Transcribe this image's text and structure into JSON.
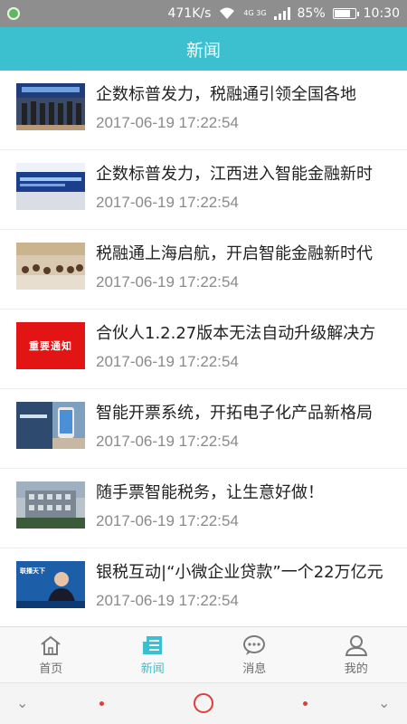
{
  "status_bar": {
    "speed": "471K/s",
    "signal": "4G 3G",
    "battery": "85%",
    "battery_level": 0.85,
    "time": "10:30"
  },
  "header": {
    "title": "新闻"
  },
  "news": [
    {
      "title": "企数标普发力，税融通引领全国各地",
      "date": "2017-06-19 17:22:54"
    },
    {
      "title": "企数标普发力，江西进入智能金融新时",
      "date": "2017-06-19 17:22:54"
    },
    {
      "title": "税融通上海启航，开启智能金融新时代",
      "date": "2017-06-19 17:22:54"
    },
    {
      "title": "合伙人1.2.27版本无法自动升级解决方",
      "date": "2017-06-19 17:22:54",
      "thumb_text": "重要通知"
    },
    {
      "title": "智能开票系统，开拓电子化产品新格局",
      "date": "2017-06-19 17:22:54"
    },
    {
      "title": "随手票智能税务，让生意好做！",
      "date": "2017-06-19 17:22:54"
    },
    {
      "title": "银税互动|“小微企业贷款”一个22万亿元",
      "date": "2017-06-19 17:22:54",
      "thumb_text": "联播天下"
    }
  ],
  "bottom_nav": [
    {
      "label": "首页",
      "icon": "home-icon",
      "active": false
    },
    {
      "label": "新闻",
      "icon": "news-icon",
      "active": true
    },
    {
      "label": "消息",
      "icon": "message-icon",
      "active": false
    },
    {
      "label": "我的",
      "icon": "profile-icon",
      "active": false
    }
  ],
  "colors": {
    "accent": "#3cbfcf",
    "status_bar": "#8e8e8e",
    "nav_system": "#e23b3b"
  }
}
